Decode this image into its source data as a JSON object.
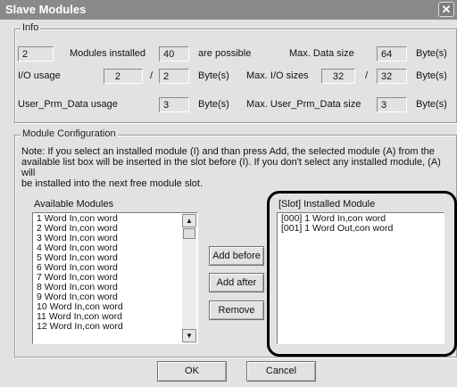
{
  "window": {
    "title": "Slave Modules",
    "close": "✕"
  },
  "info": {
    "group_label": "Info",
    "modules_installed": "2",
    "modules_installed_label": "Modules installed",
    "possible": "40",
    "possible_label": "are possible",
    "max_data_label": "Max. Data size",
    "max_data": "64",
    "max_data_unit": "Byte(s)",
    "io_usage_label": "I/O usage",
    "io_in": "2",
    "io_sep": "/",
    "io_out": "2",
    "io_unit": "Byte(s)",
    "max_io_label": "Max. I/O sizes",
    "max_io_in": "32",
    "max_io_sep": "/",
    "max_io_out": "32",
    "max_io_unit": "Byte(s)",
    "prm_label": "User_Prm_Data usage",
    "prm": "3",
    "prm_unit": "Byte(s)",
    "max_prm_label": "Max. User_Prm_Data size",
    "max_prm": "3",
    "max_prm_unit": "Byte(s)"
  },
  "config": {
    "group_label": "Module Configuration",
    "note_line1": "Note:   If you select an installed module (I) and than press Add, the selected module (A) from the",
    "note_line2": "available list box will be inserted in the slot before (I). If you don't select any installed module, (A) will",
    "note_line3": "be installed into the next free module slot.",
    "available_label": "Available Modules",
    "installed_label": "[Slot] Installed Module",
    "available": [
      "1 Word In,con word",
      "2 Word In,con word",
      "3 Word In,con word",
      "4 Word In,con word",
      "5 Word In,con word",
      "6 Word In,con word",
      "7 Word In,con word",
      "8 Word In,con word",
      "9 Word In,con word",
      "10 Word In,con word",
      "11 Word In,con word",
      "12 Word In,con word"
    ],
    "installed": [
      "[000] 1 Word In,con word",
      "[001] 1 Word Out,con word"
    ],
    "add_before": "Add before",
    "add_after": "Add after",
    "remove": "Remove"
  },
  "buttons": {
    "ok": "OK",
    "cancel": "Cancel"
  }
}
